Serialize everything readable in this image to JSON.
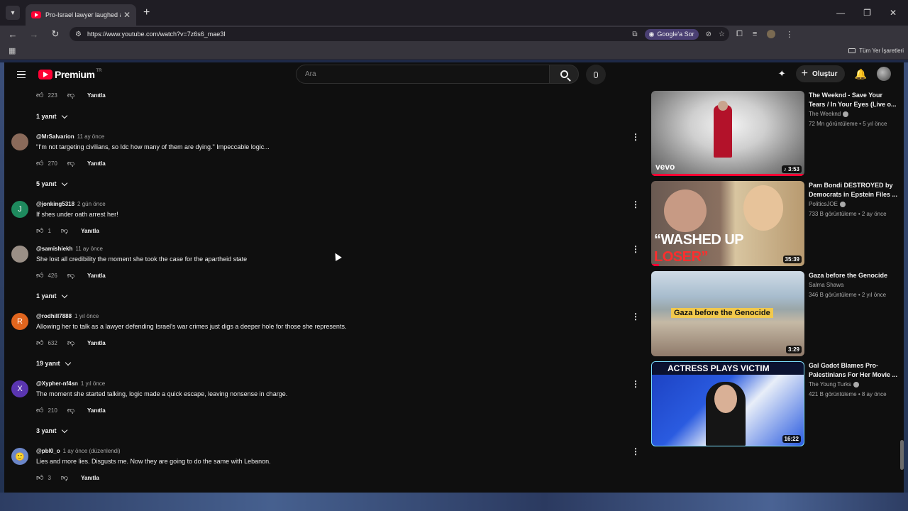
{
  "browser": {
    "tab_title": "Pro-Israel lawyer laughed at by",
    "url": "https://www.youtube.com/watch?v=7z6s6_mae3I",
    "gemini_label": "Google'a Sor",
    "all_bookmarks": "Tüm Yer İşaretleri"
  },
  "youtube": {
    "logo_text": "Premium",
    "region": "TR",
    "search_placeholder": "Ara",
    "create_label": "Oluştur"
  },
  "top_partial": {
    "likes": "223",
    "reply": "Yanıtla",
    "replies": "1 yanıt"
  },
  "comments": [
    {
      "author": "@MrSalvarion",
      "time": "11 ay önce",
      "text": "\"I'm not targeting civilians, so Idc how many of them are dying.\" Impeccable logic...",
      "likes": "270",
      "reply": "Yanıtla",
      "replies": "5 yanıt",
      "avatar_letter": "",
      "avatar_color": "#8a6a5a"
    },
    {
      "author": "@jonking5318",
      "time": "2 gün önce",
      "text": "If shes under oath arrest her!",
      "likes": "1",
      "reply": "Yanıtla",
      "replies": "",
      "avatar_letter": "J",
      "avatar_color": "#1e8a5e"
    },
    {
      "author": "@samishiekh",
      "time": "11 ay önce",
      "text": "She lost all credibility the moment she took the case for the apartheid state",
      "likes": "426",
      "reply": "Yanıtla",
      "replies": "1 yanıt",
      "avatar_letter": "",
      "avatar_color": "#9a8f86"
    },
    {
      "author": "@rodhill7888",
      "time": "1 yıl önce",
      "text": "Allowing her to talk as a lawyer defending Israel's war crimes just digs a deeper hole for those she represents.",
      "likes": "632",
      "reply": "Yanıtla",
      "replies": "19 yanıt",
      "avatar_letter": "R",
      "avatar_color": "#e0651e"
    },
    {
      "author": "@Xypher-nf4sn",
      "time": "1 yıl önce",
      "text": "The moment she started talking, logic made a quick escape, leaving nonsense in charge.",
      "likes": "210",
      "reply": "Yanıtla",
      "replies": "3 yanıt",
      "avatar_letter": "X",
      "avatar_color": "#5a35b0"
    },
    {
      "author": "@pbl0_o",
      "time": "1 ay önce (düzenlendi)",
      "text": "Lies and more lies. Disgusts me. Now they are going to do the same with Lebanon.",
      "likes": "3",
      "reply": "Yanıtla",
      "replies": "",
      "avatar_letter": "",
      "avatar_color": "#6b86c8"
    }
  ],
  "recommendations": [
    {
      "title": "The Weeknd - Save Your Tears / In Your Eyes (Live o...",
      "channel": "The Weeknd",
      "views": "72 Mn görüntüleme",
      "age": "5 yıl önce",
      "duration": "3:53",
      "thumb_label": "vevo",
      "progress": 1.0
    },
    {
      "title": "Pam Bondi DESTROYED by Democrats in Epstein Files ...",
      "channel": "PoliticsJOE",
      "views": "733 B görüntüleme",
      "age": "2 ay önce",
      "duration": "35:39",
      "thumb_label": "“WASHED UP",
      "thumb_label2": "LOSER”",
      "progress": 0.05
    },
    {
      "title": "Gaza before the Genocide",
      "channel": "Salma Shawa",
      "views": "346 B görüntüleme",
      "age": "2 yıl önce",
      "duration": "3:29",
      "thumb_label": "Gaza before the Genocide",
      "progress": 0
    },
    {
      "title": "Gal Gadot Blames Pro-Palestinians For Her Movie ...",
      "channel": "The Young Turks",
      "views": "421 B görüntüleme",
      "age": "8 ay önce",
      "duration": "16:22",
      "thumb_label": "ACTRESS PLAYS VICTIM",
      "progress": 0
    }
  ]
}
